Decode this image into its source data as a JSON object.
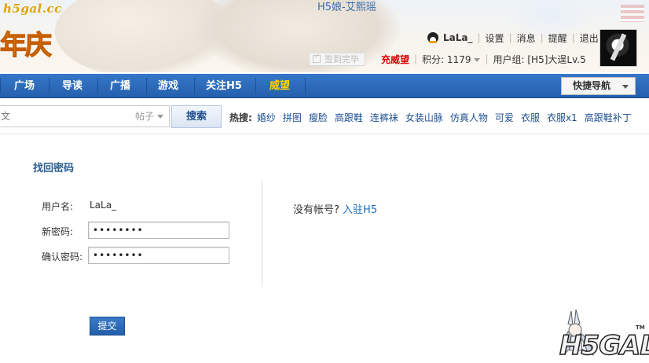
{
  "header": {
    "logo_url": "h5gal.cc",
    "logo_anniversary": "年庆",
    "site_title": "H5娘-艾熙瑶",
    "user": {
      "username": "LaLa_",
      "links": [
        "设置",
        "消息",
        "提醒",
        "退出"
      ]
    },
    "checkin_label": "签到完毕",
    "prestige_label": "充威望",
    "points_label": "积分: 1179",
    "usergroup_label": "用户组: [H5]大逞Lv.5"
  },
  "nav": {
    "items": [
      "广场",
      "导读",
      "广播",
      "游戏",
      "关注H5",
      "威望"
    ],
    "quick_nav_label": "快捷导航"
  },
  "search": {
    "placeholder": "文",
    "type_label": "帖子",
    "button_label": "搜索",
    "hot_label": "热搜:",
    "hot_words": [
      "婚纱",
      "拼图",
      "瘦脸",
      "高跟鞋",
      "连裤袜",
      "女装山脉",
      "仿真人物",
      "可爱",
      "衣服",
      "衣服x1",
      "高跟鞋补丁"
    ]
  },
  "form": {
    "title": "找回密码",
    "username_label": "用户名:",
    "username_value": "LaLa_",
    "new_password_label": "新密码:",
    "new_password_value": "••••••••",
    "confirm_password_label": "确认密码:",
    "confirm_password_value": "••••••••",
    "submit_label": "提交"
  },
  "side": {
    "no_account_text": "没有帐号?",
    "join_link": "入驻H5"
  },
  "footer": {
    "logo_text": "H5GAL",
    "tm": "TM"
  },
  "colors": {
    "nav_blue": "#2a62b3",
    "link_blue": "#1d4f8f",
    "prestige_red": "#d40000",
    "nav_highlight": "#ffd200"
  }
}
